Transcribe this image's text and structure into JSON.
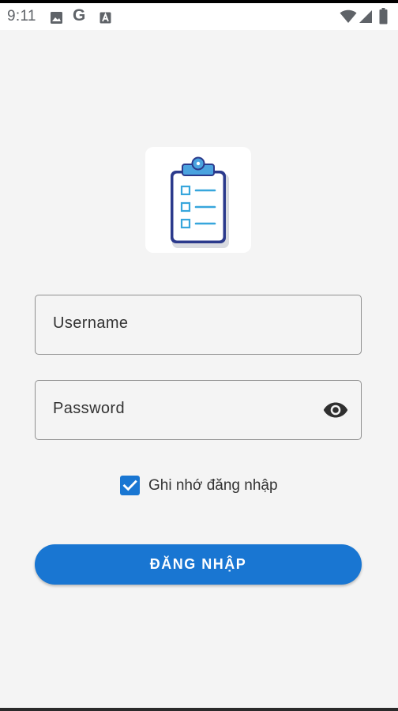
{
  "status_bar": {
    "time": "9:11",
    "icons": [
      "image-icon",
      "google-icon",
      "font-a-icon",
      "wifi-icon",
      "cellular-signal-icon",
      "battery-icon"
    ]
  },
  "logo": {
    "icon": "clipboard-checklist-icon",
    "colors": {
      "clip": "#4aa3df",
      "outline": "#2b3a8c",
      "lines": "#37a6dc"
    }
  },
  "login_form": {
    "username": {
      "placeholder": "Username",
      "value": ""
    },
    "password": {
      "placeholder": "Password",
      "value": "",
      "toggle_icon": "eye-icon"
    },
    "remember_me": {
      "label": "Ghi nhớ đăng nhập",
      "checked": true
    },
    "submit_label": "ĐĂNG NHẬP"
  },
  "colors": {
    "accent": "#1976d2",
    "background": "#f4f4f4",
    "field_border": "#8f8f8f"
  }
}
